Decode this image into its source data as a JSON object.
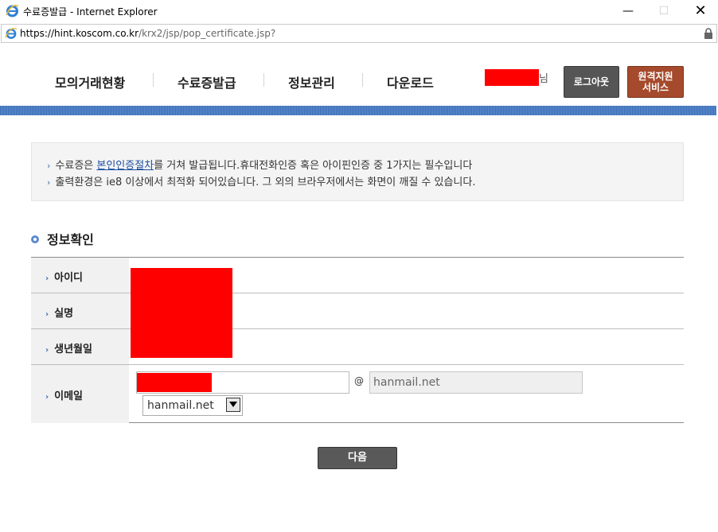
{
  "window": {
    "title": "수료증발급 - Internet Explorer",
    "minimize": "—",
    "maximize": "☐",
    "close": "✕"
  },
  "address": {
    "url_host": "https://hint.koscom.co.kr",
    "url_path": "/krx2/jsp/pop_certificate.jsp?"
  },
  "nav": {
    "items": [
      "모의거래현황",
      "수료증발급",
      "정보관리",
      "다운로드"
    ],
    "user_suffix": "님",
    "logout_label": "로그아웃",
    "remote_label_line1": "원격지원",
    "remote_label_line2": "서비스"
  },
  "notice": {
    "line1_pre": "수료증은 ",
    "line1_link": "본인인증절차",
    "line1_post": "를 거쳐 발급됩니다.휴대전화인증 혹은 아이핀인증 중 1가지는 필수입니다",
    "line2": "출력환경은 ie8 이상에서 최적화 되어있습니다. 그 외의 브라우저에서는 화면이 깨질 수 있습니다.",
    "bullet": "›"
  },
  "section": {
    "title": "정보확인"
  },
  "form": {
    "arrow": "›",
    "labels": {
      "id": "아이디",
      "name": "실명",
      "birth": "생년월일",
      "email": "이메일"
    },
    "email_at": "@",
    "email_domain_value": "hanmail.net",
    "domain_select_value": "hanmail.net"
  },
  "actions": {
    "next_label": "다음"
  },
  "colors": {
    "accent_blue": "#3d6fb4",
    "remote_button": "#a54a2c",
    "redaction": "#ff0000"
  }
}
